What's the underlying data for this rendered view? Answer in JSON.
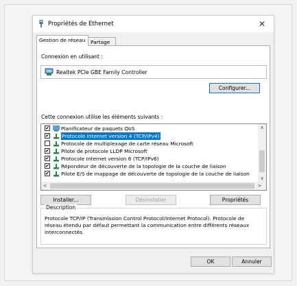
{
  "window": {
    "title": "Propriétés de Ethernet",
    "close_glyph": "✕"
  },
  "tabs": [
    {
      "label": "Gestion de réseau",
      "active": true
    },
    {
      "label": "Partage",
      "active": false
    }
  ],
  "connection": {
    "label": "Connexion en utilisant :",
    "adapter": "Realtek PCIe GBE Family Controller",
    "configure_button": "Configurer..."
  },
  "items_section": {
    "label": "Cette connexion utilise les éléments suivants :",
    "items": [
      {
        "label": "Planificateur de paquets QoS",
        "checked": true,
        "selected": false,
        "icon": "qos-scheduler-icon"
      },
      {
        "label": "Protocole Internet version 4 (TCP/IPv4)",
        "checked": true,
        "selected": true,
        "icon": "network-protocol-icon"
      },
      {
        "label": "Protocole de multiplexage de carte réseau Microsoft",
        "checked": false,
        "selected": false,
        "icon": "network-protocol-icon"
      },
      {
        "label": "Pilote de protocole LLDP Microsoft",
        "checked": true,
        "selected": false,
        "icon": "network-protocol-icon"
      },
      {
        "label": "Protocole Internet version 6 (TCP/IPv6)",
        "checked": true,
        "selected": false,
        "icon": "network-protocol-icon"
      },
      {
        "label": "Répondeur de découverte de la topologie de la couche de liaison",
        "checked": true,
        "selected": false,
        "icon": "network-protocol-icon"
      },
      {
        "label": "Pilote E/S de mappage de découverte de topologie de la couche de liaison",
        "checked": true,
        "selected": false,
        "icon": "network-protocol-icon"
      }
    ],
    "check_glyph": "✔",
    "scroll_up_glyph": "∧",
    "scroll_down_glyph": "∨",
    "scroll_left_glyph": "<",
    "scroll_right_glyph": ">"
  },
  "actions": {
    "install": "Installer...",
    "uninstall": "Désinstaller",
    "properties": "Propriétés"
  },
  "description": {
    "legend": "Description",
    "text": "Protocole TCP/IP (Transmission Control Protocol/Internet Protocol). Protocole de réseau étendu par défaut permettant la communication entre différents réseaux interconnectés."
  },
  "footer": {
    "ok": "OK",
    "cancel": "Annuler"
  },
  "colors": {
    "selection": "#0078d7",
    "protocol_icon": "#1e8c3a"
  }
}
